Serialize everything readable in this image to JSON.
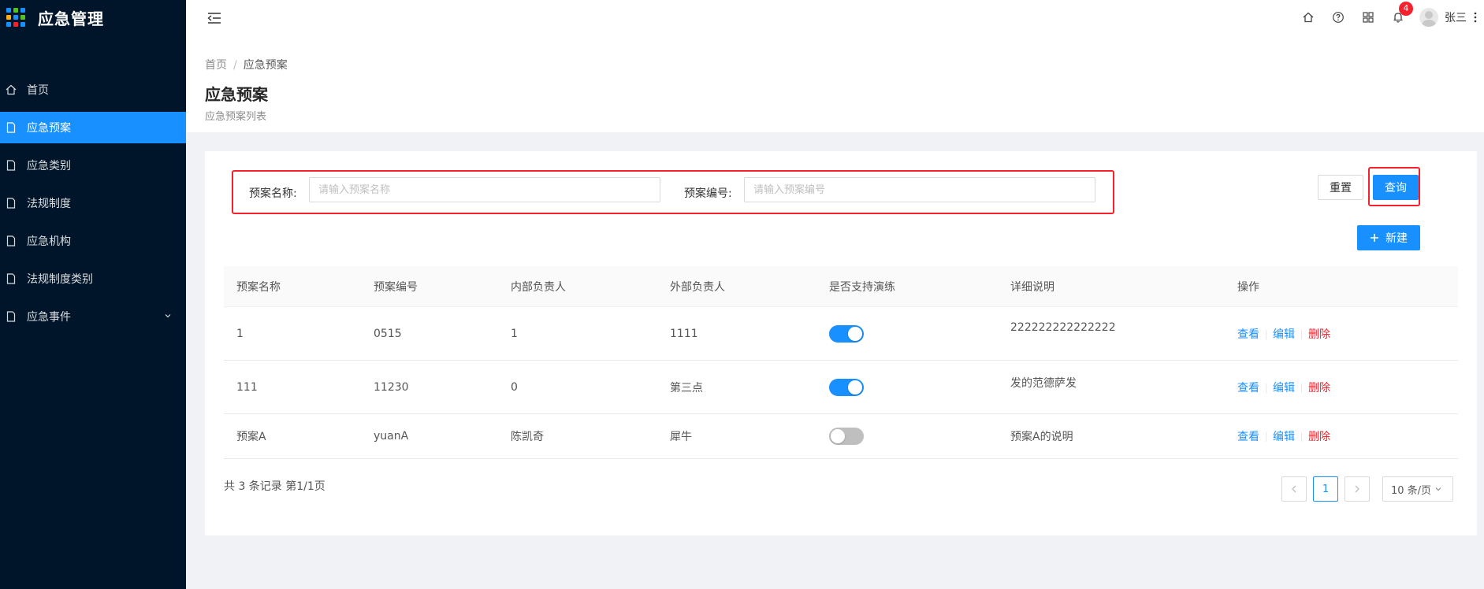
{
  "app": {
    "title": "应急管理"
  },
  "sidebar": {
    "items": [
      {
        "label": "首页",
        "icon": "home-icon",
        "active": false
      },
      {
        "label": "应急预案",
        "icon": "document-icon",
        "active": true
      },
      {
        "label": "应急类别",
        "icon": "document-icon",
        "active": false
      },
      {
        "label": "法规制度",
        "icon": "document-icon",
        "active": false
      },
      {
        "label": "应急机构",
        "icon": "document-icon",
        "active": false
      },
      {
        "label": "法规制度类别",
        "icon": "document-icon",
        "active": false
      },
      {
        "label": "应急事件",
        "icon": "document-icon",
        "active": false,
        "expandable": true
      }
    ]
  },
  "header": {
    "notification_count": "4",
    "username": "张三"
  },
  "breadcrumb": {
    "home": "首页",
    "separator": "/",
    "current": "应急预案"
  },
  "page": {
    "title": "应急预案",
    "subtitle": "应急预案列表"
  },
  "search": {
    "name_label": "预案名称:",
    "name_placeholder": "请输入预案名称",
    "code_label": "预案编号:",
    "code_placeholder": "请输入预案编号",
    "reset_label": "重置",
    "query_label": "查询",
    "new_label": "新建"
  },
  "table": {
    "columns": [
      "预案名称",
      "预案编号",
      "内部负责人",
      "外部负责人",
      "是否支持演练",
      "详细说明",
      "操作"
    ],
    "rows": [
      {
        "name": "1",
        "code": "0515",
        "internal": "1",
        "external": "1111",
        "drill": true,
        "detail": "222222222222222"
      },
      {
        "name": "111",
        "code": "11230",
        "internal": "0",
        "external": "第三点",
        "drill": true,
        "detail": "发的范德萨发"
      },
      {
        "name": "预案A",
        "code": "yuanA",
        "internal": "陈凯奇",
        "external": "犀牛",
        "drill": false,
        "detail": "预案A的说明"
      }
    ],
    "actions": {
      "view": "查看",
      "edit": "编辑",
      "delete": "删除"
    }
  },
  "pagination": {
    "summary": "共 3 条记录 第1/1页",
    "current_page": "1",
    "page_size": "10 条/页"
  },
  "colors": {
    "primary": "#1890ff",
    "sidebar": "#001529",
    "danger": "#f5222d"
  }
}
